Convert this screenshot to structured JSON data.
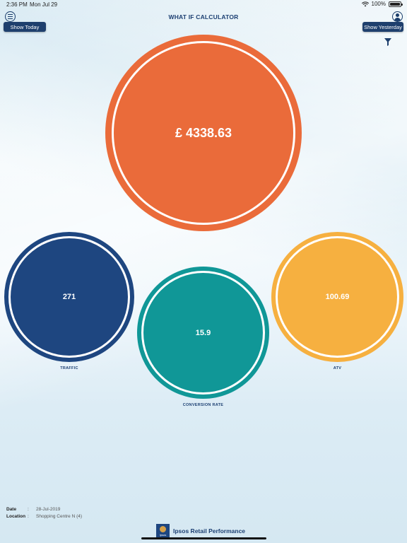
{
  "status_bar": {
    "time": "2:36 PM",
    "date": "Mon Jul 29",
    "battery_percent": "100%"
  },
  "header": {
    "title": "WHAT IF CALCULATOR",
    "show_today_label": "Show Today",
    "show_yesterday_label": "Show Yesterday"
  },
  "metrics": {
    "revenue": {
      "value": "£ 4338.63",
      "color": "#ea6b3a"
    },
    "traffic": {
      "value": "271",
      "label": "TRAFFIC",
      "color": "#1e4680"
    },
    "conversion_rate": {
      "value": "15.9",
      "label": "CONVERSION RATE",
      "color": "#109797"
    },
    "atv": {
      "value": "100.69",
      "label": "ATV",
      "color": "#f6b040"
    }
  },
  "info": {
    "date_key": "Date",
    "date_colon": ":",
    "date_value": "28-Jul-2019",
    "location_key": "Location",
    "location_colon": ":",
    "location_value": "Shopping Centre N (4)"
  },
  "footer": {
    "logo_box_text": "Ipsos",
    "brand": "Ipsos Retail Performance"
  },
  "icons": [
    "menu-icon",
    "user-icon",
    "filter-icon",
    "wifi-icon",
    "battery-icon"
  ]
}
